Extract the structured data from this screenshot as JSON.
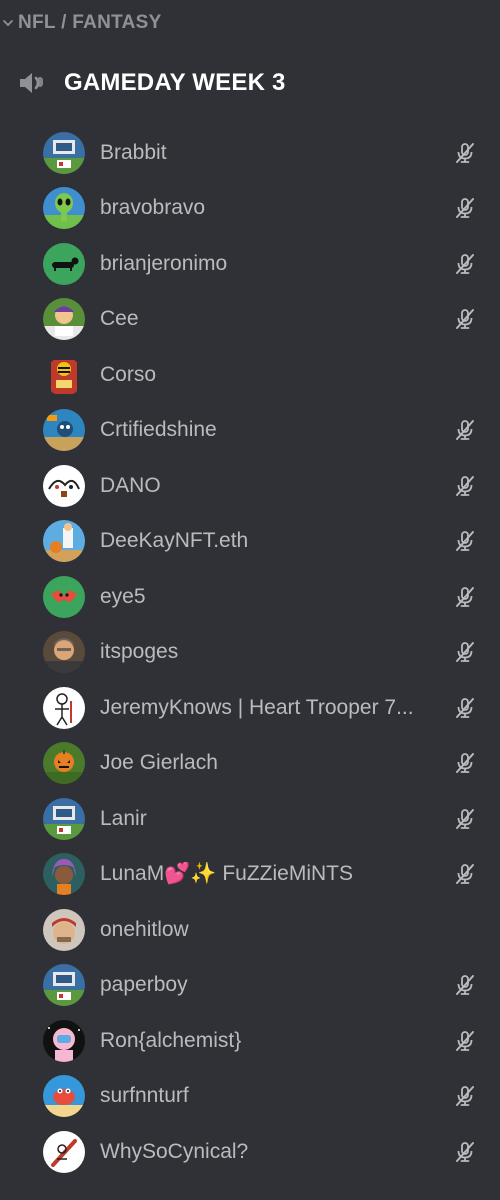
{
  "category": {
    "label": "NFL / FANTASY",
    "icon": "chevron-down-icon"
  },
  "voice_channel": {
    "name": "GAMEDAY WEEK 3",
    "icon": "speaker-icon"
  },
  "colors": {
    "background": "#2f3136",
    "username": "#b9bbbe",
    "category": "#8e9297",
    "channel_name": "#ffffff",
    "mute_icon": "#b9bbbe"
  },
  "users": [
    {
      "name": "Brabbit",
      "muted": true,
      "avatar": "pixel-field-blue"
    },
    {
      "name": "bravobravo",
      "muted": true,
      "avatar": "green-alien"
    },
    {
      "name": "brianjeronimo",
      "muted": true,
      "avatar": "dachshund-green"
    },
    {
      "name": "Cee",
      "muted": true,
      "avatar": "cartoon-green"
    },
    {
      "name": "Corso",
      "muted": false,
      "avatar": "bee-red"
    },
    {
      "name": "Crtifiedshine",
      "muted": true,
      "avatar": "stadium-blue"
    },
    {
      "name": "DANO",
      "muted": true,
      "avatar": "white-cartoon"
    },
    {
      "name": "DeeKayNFT.eth",
      "muted": true,
      "avatar": "basketball-blue"
    },
    {
      "name": "eye5",
      "muted": true,
      "avatar": "green-red-bat"
    },
    {
      "name": "itspoges",
      "muted": true,
      "avatar": "photo-man"
    },
    {
      "name": "JeremyKnows | Heart Trooper 7...",
      "muted": true,
      "avatar": "white-sketch"
    },
    {
      "name": "Joe Gierlach",
      "muted": true,
      "avatar": "pumpkin-field"
    },
    {
      "name": "Lanir",
      "muted": true,
      "avatar": "pixel-field-blue"
    },
    {
      "name": "LunaM💕✨ FuZZieMiNTS",
      "muted": true,
      "avatar": "purple-hair"
    },
    {
      "name": "onehitlow",
      "muted": false,
      "avatar": "photo-cap"
    },
    {
      "name": "paperboy",
      "muted": true,
      "avatar": "pixel-field-blue"
    },
    {
      "name": "Ron{alchemist}",
      "muted": true,
      "avatar": "pink-astronaut"
    },
    {
      "name": "surfnnturf",
      "muted": true,
      "avatar": "red-crab"
    },
    {
      "name": "WhySoCynical?",
      "muted": true,
      "avatar": "white-skate"
    }
  ]
}
